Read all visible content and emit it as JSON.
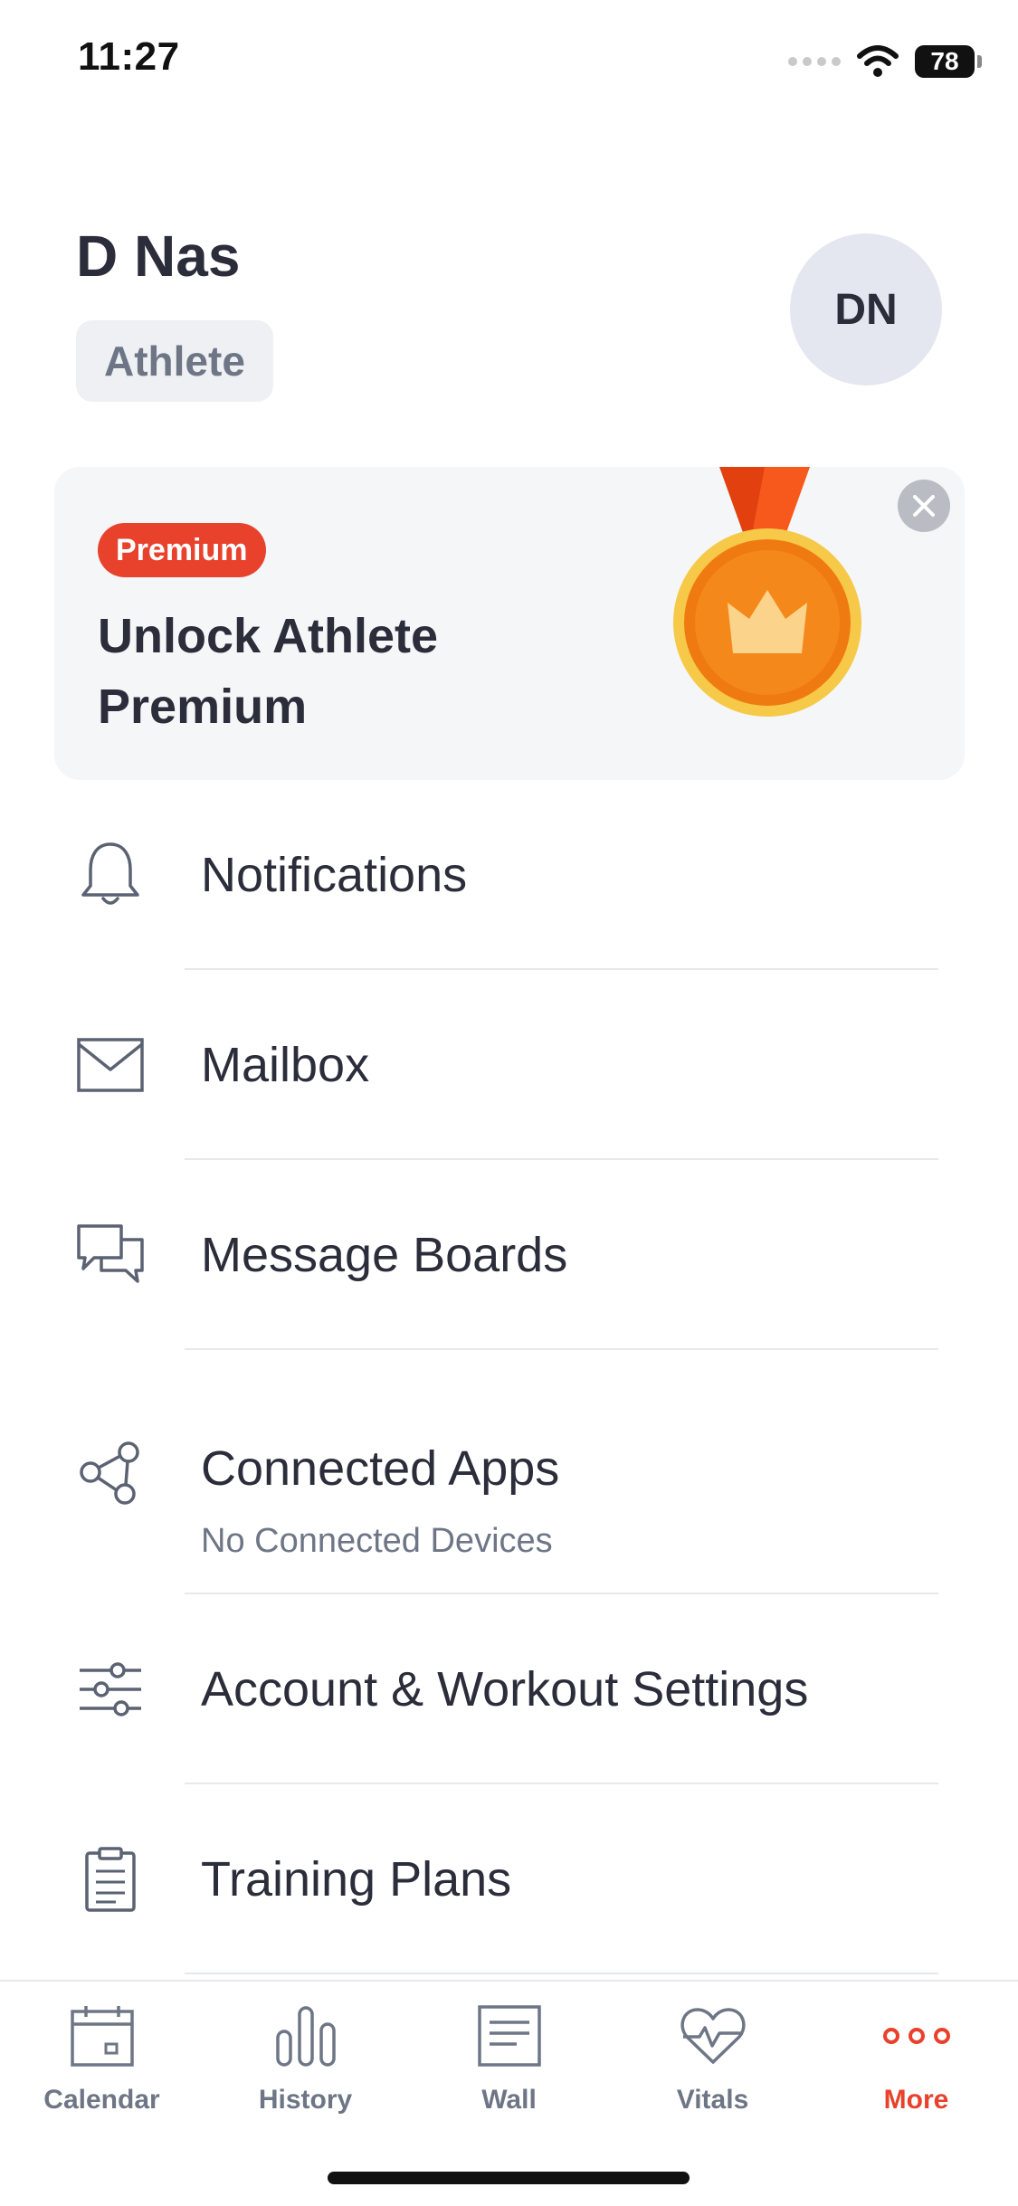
{
  "status_bar": {
    "time": "11:27",
    "battery": "78"
  },
  "profile": {
    "name": "D Nas",
    "role": "Athlete",
    "avatar_initials": "DN"
  },
  "premium_card": {
    "badge": "Premium",
    "title": "Unlock Athlete Premium"
  },
  "menu": {
    "items": [
      {
        "label": "Notifications",
        "icon": "bell-icon"
      },
      {
        "label": "Mailbox",
        "icon": "envelope-icon"
      },
      {
        "label": "Message Boards",
        "icon": "chat-bubbles-icon"
      },
      {
        "label": "Connected Apps",
        "sublabel": "No Connected Devices",
        "icon": "connected-nodes-icon"
      },
      {
        "label": "Account & Workout Settings",
        "icon": "sliders-icon"
      },
      {
        "label": "Training Plans",
        "icon": "clipboard-icon"
      }
    ]
  },
  "tab_bar": {
    "tabs": [
      {
        "label": "Calendar",
        "icon": "calendar-icon"
      },
      {
        "label": "History",
        "icon": "bar-chart-icon"
      },
      {
        "label": "Wall",
        "icon": "wall-icon"
      },
      {
        "label": "Vitals",
        "icon": "heart-pulse-icon"
      },
      {
        "label": "More",
        "icon": "more-dots-icon",
        "active": true
      }
    ]
  },
  "colors": {
    "accent": "#e8412c",
    "text": "#2b2d3a",
    "muted": "#6e7686",
    "medal_orange": "#f07a12",
    "medal_gold": "#f7c948"
  }
}
